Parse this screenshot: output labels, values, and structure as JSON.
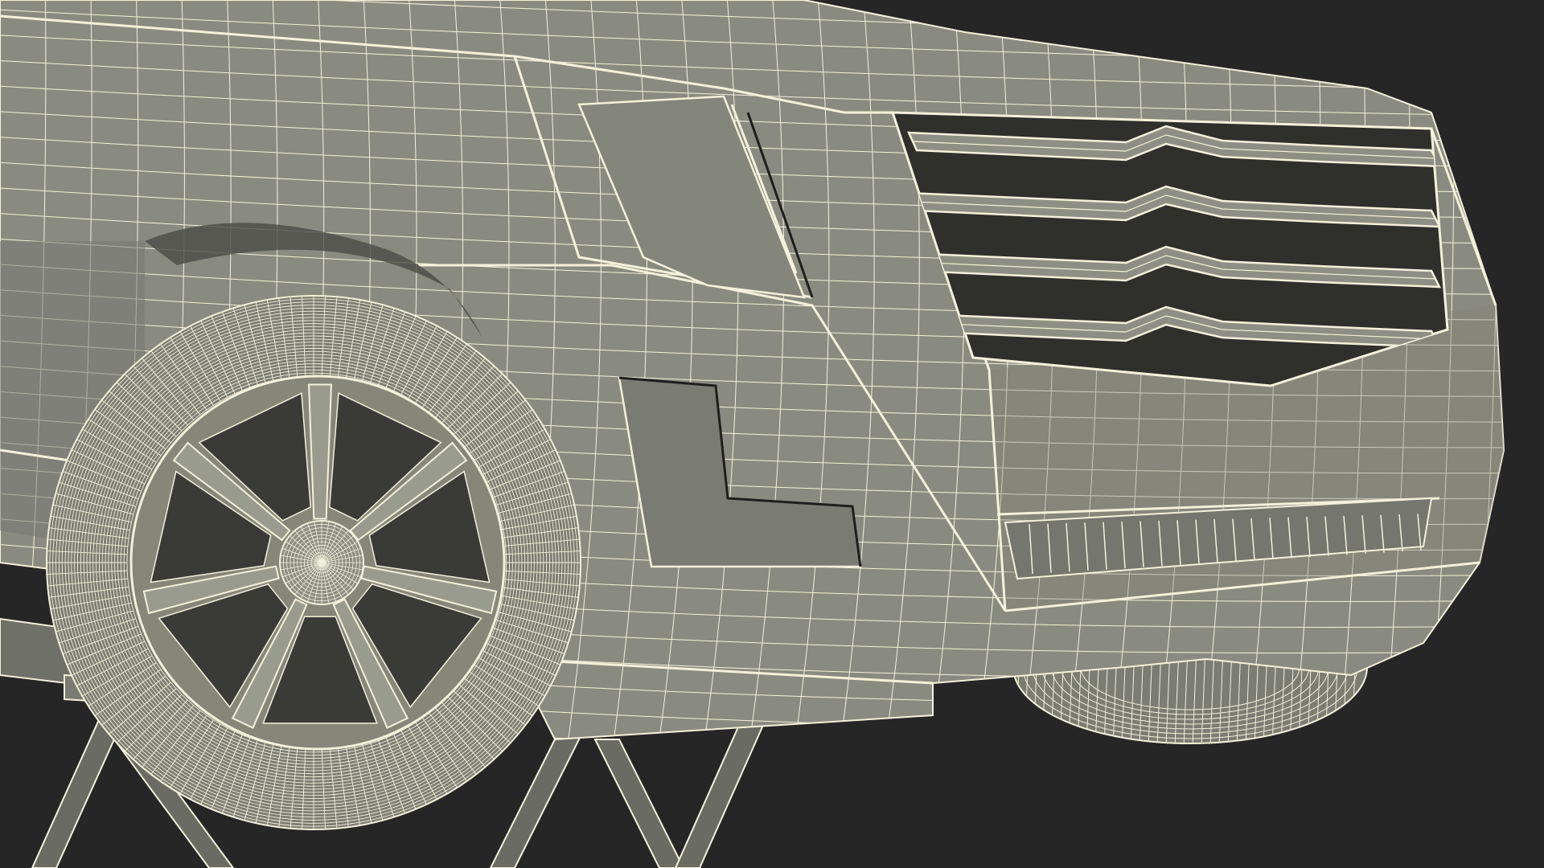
{
  "scene": {
    "background": "#262626",
    "surface_color": "#8a8b80",
    "surface_dark": "#5f6058",
    "wire_color": "#f3f1dc",
    "recess_color": "#2f302c"
  },
  "wireframe": {
    "body_u": 34,
    "body_v": 30,
    "wheel_rings": 26,
    "wheel_spokes": 72,
    "hub_rings": 12,
    "hub_spokes": 36,
    "grille_bars": 4
  }
}
